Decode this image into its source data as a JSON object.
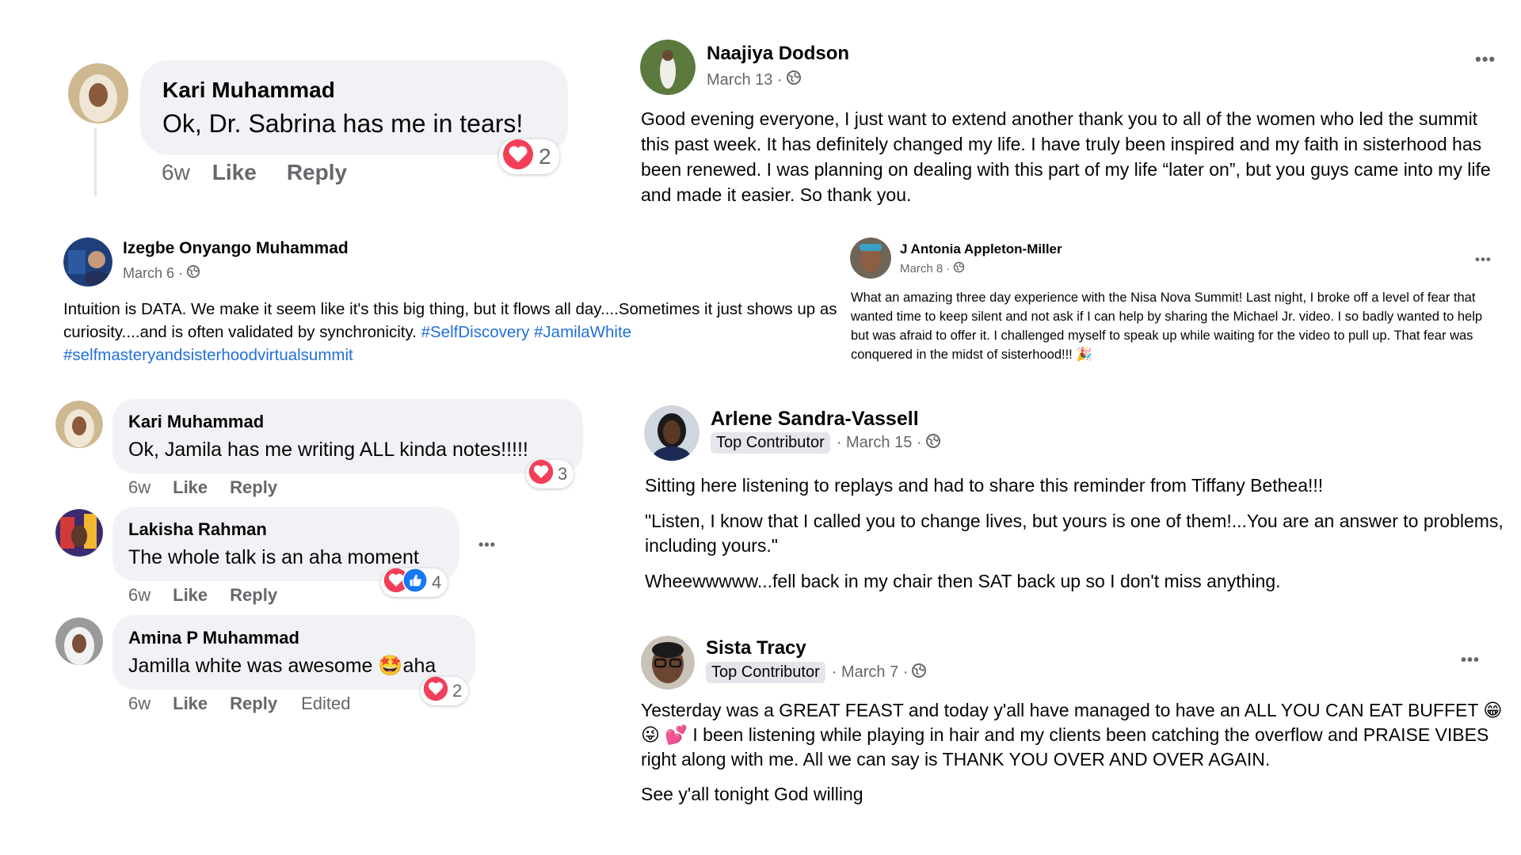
{
  "c1": {
    "name": "Kari Muhammad",
    "text": "Ok, Dr. Sabrina has me in tears!",
    "time": "6w",
    "like": "Like",
    "reply": "Reply",
    "reaction_count": "2"
  },
  "p1": {
    "name": "Naajiya Dodson",
    "date": "March 13 ·",
    "text": "Good evening everyone, I just want to extend another thank you to all of the women who led the summit this past week. It has definitely changed my life. I have truly been inspired and my faith in sisterhood has been renewed. I was planning on dealing with this part of my life “later on”, but you guys came into my life and made it easier. So thank you."
  },
  "p2": {
    "name": "Izegbe Onyango Muhammad",
    "date": "March 6 ·",
    "text": "Intuition is DATA. We make it seem like it's this big thing, but it flows all day....Sometimes it just shows up as curiosity....and is often validated by synchronicity.",
    "tag1": "#SelfDiscovery",
    "tag2": "#JamilaWhite",
    "tag3": "#selfmasteryandsisterhoodvirtualsummit"
  },
  "p3": {
    "name": "J Antonia Appleton-Miller",
    "date": "March 8 ·",
    "text": "What an amazing three day experience with the Nisa Nova Summit! Last night, I broke off a level of fear that wanted time to keep silent and not ask if I can help by sharing the Michael Jr. video. I so badly wanted to help but was afraid to offer it. I challenged myself to speak up while waiting for the video to pull up. That fear was conquered in the midst of sisterhood!!! 🎉"
  },
  "c2": {
    "name": "Kari Muhammad",
    "text": "Ok, Jamila has me writing ALL kinda notes!!!!!",
    "time": "6w",
    "like": "Like",
    "reply": "Reply",
    "reaction_count": "3"
  },
  "c3": {
    "name": "Lakisha Rahman",
    "text": "The whole talk is an aha moment",
    "time": "6w",
    "like": "Like",
    "reply": "Reply",
    "reaction_count": "4"
  },
  "c4": {
    "name": "Amina P Muhammad",
    "text_before": "Jamilla white was awesome ",
    "emoji": "🤩",
    "text_after": "aha",
    "time": "6w",
    "like": "Like",
    "reply": "Reply",
    "edited": "Edited",
    "reaction_count": "2"
  },
  "p4": {
    "name": "Arlene Sandra-Vassell",
    "badge": "Top Contributor",
    "date": "· March 15 ·",
    "para1": "Sitting here listening to replays and had to share this reminder from Tiffany Bethea!!!",
    "para2": "\"Listen, I know that I called you to change lives, but yours is one of them!...You are an answer to problems, including yours.\"",
    "para3": "Wheewwwww...fell back in my chair then SAT back up so I don't miss anything."
  },
  "p5": {
    "name": "Sista Tracy",
    "badge": "Top Contributor",
    "date": "· March 7 ·",
    "para1": "Yesterday was a GREAT FEAST and today y'all have managed to have an ALL YOU CAN EAT BUFFET 😁😜 💕 I been listening while playing in hair and my clients been catching the overflow and PRAISE VIBES right along with me. All we can say is THANK YOU OVER AND OVER AGAIN.",
    "para2": "See y'all tonight God willing"
  },
  "icons": {
    "love_color": "#f33e58",
    "like_color": "#1877f2",
    "hashtag_color": "#216fdb",
    "more": "more-icon",
    "globe": "globe-icon"
  }
}
